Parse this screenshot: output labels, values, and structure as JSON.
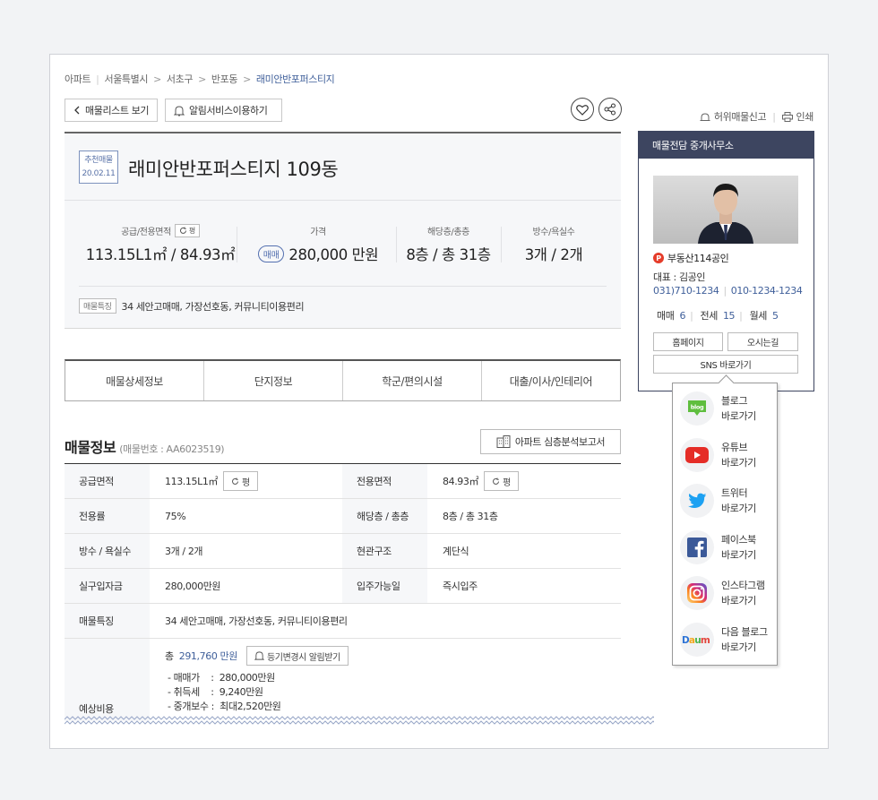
{
  "breadcrumb": [
    "아파트",
    "서울특별시",
    "서초구",
    "반포동",
    "래미안반포퍼스티지"
  ],
  "toolbar": {
    "list_btn": "매물리스트 보기",
    "alarm_btn": "알림서비스이용하기"
  },
  "top_links": {
    "report": "허위매물신고",
    "print": "인쇄"
  },
  "summary": {
    "badge_line1": "추천매물",
    "badge_line2": "20.02.11",
    "title": "래미안반포퍼스티지 109동",
    "area_label": "공급/전용면적",
    "area_toggle": "평",
    "area_value": "113.15L1㎡ / 84.93㎡",
    "price_label": "가격",
    "price_type": "매매",
    "price_value": "280,000 만원",
    "floor_label": "해당층/총층",
    "floor_value": "8층 / 총 31층",
    "room_label": "방수/욕실수",
    "room_value": "3개 / 2개",
    "feature_tag": "매물특징",
    "feature_text": "34 세안고매매, 가장선호동, 커뮤니티이용편리"
  },
  "tabs": [
    "매물상세정보",
    "단지정보",
    "학군/편의시설",
    "대출/이사/인테리어"
  ],
  "section": {
    "title": "매물정보",
    "number": "(매물번호 : AA6023519)",
    "report_btn": "아파트 심층분석보고서"
  },
  "table": {
    "r1": {
      "h1": "공급면적",
      "v1": "113.15L1㎡",
      "h2": "전용면적",
      "v2": "84.93㎡",
      "toggle": "평"
    },
    "r2": {
      "h1": "전용률",
      "v1": "75%",
      "h2": "해당층 / 총층",
      "v2": "8층 / 총 31층"
    },
    "r3": {
      "h1": "방수 / 욕실수",
      "v1": "3개 / 2개",
      "h2": "현관구조",
      "v2": "계단식"
    },
    "r4": {
      "h1": "실구입자금",
      "v1": "280,000만원",
      "h2": "입주가능일",
      "v2": "즉시입주"
    },
    "r5": {
      "h1": "매물특징",
      "v1": "34 세안고매매, 가장선호동, 커뮤니티이용편리"
    },
    "cost": {
      "h": "예상비용",
      "total_prefix": "총",
      "total": "291,760 만원",
      "alarm_btn": "등기변경시 알림받기",
      "lines": [
        "- 매매가    :  280,000만원",
        "- 취득세    :  9,240만원",
        "- 중개보수 :  최대2,520만원"
      ]
    }
  },
  "agent": {
    "header": "매물전담 중개사무소",
    "name": "부동산114공인",
    "rep": "대표 : 김공인",
    "phone1": "031)710-1234",
    "phone2": "010-1234-1234",
    "sale_label": "매매",
    "sale_count": "6",
    "jeonse_label": "전세",
    "jeonse_count": "15",
    "monthly_label": "월세",
    "monthly_count": "5",
    "homepage_btn": "홈페이지",
    "directions_btn": "오시는길",
    "sns_btn": "SNS 바로가기"
  },
  "sns": [
    {
      "l1": "블로그",
      "l2": "바로가기",
      "icon": "blog-icon"
    },
    {
      "l1": "유튜브",
      "l2": "바로가기",
      "icon": "youtube-icon"
    },
    {
      "l1": "트위터",
      "l2": "바로가기",
      "icon": "twitter-icon"
    },
    {
      "l1": "페이스북",
      "l2": "바로가기",
      "icon": "facebook-icon"
    },
    {
      "l1": "인스타그램",
      "l2": "바로가기",
      "icon": "instagram-icon"
    },
    {
      "l1": "다음 블로그",
      "l2": "바로가기",
      "icon": "daum-icon"
    }
  ],
  "colors": {
    "accent": "#3f5f9a",
    "agent_header": "#3d4560",
    "blog": "#5fbe3e",
    "youtube": "#e52d27",
    "twitter": "#1da1f2",
    "facebook": "#3b5998"
  }
}
